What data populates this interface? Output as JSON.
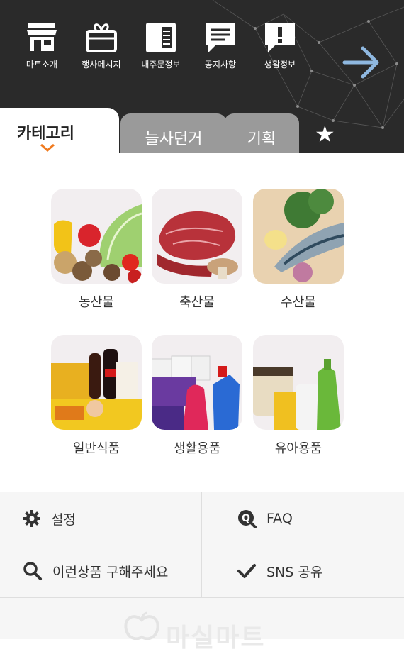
{
  "top_menu": [
    {
      "label": "마트소개",
      "icon": "store-icon"
    },
    {
      "label": "행사메시지",
      "icon": "gift-icon"
    },
    {
      "label": "내주문정보",
      "icon": "book-icon"
    },
    {
      "label": "공지사항",
      "icon": "message-icon"
    },
    {
      "label": "생활정보",
      "icon": "alert-message-icon"
    }
  ],
  "next_icon": "arrow-right-icon",
  "tabs": {
    "active": "카테고리",
    "others": [
      "늘사던거",
      "기획"
    ],
    "favorite_icon": "star-icon"
  },
  "categories": [
    {
      "label": "농산물"
    },
    {
      "label": "축산물"
    },
    {
      "label": "수산물"
    },
    {
      "label": "일반식품"
    },
    {
      "label": "생활용품"
    },
    {
      "label": "유아용품"
    }
  ],
  "bottom_menu": {
    "settings": "설정",
    "faq": "FAQ",
    "request": "이런상품 구해주세요",
    "sns": "SNS 공유"
  },
  "logo_text": "마실마트",
  "colors": {
    "accent": "#f07a1e",
    "header_bg": "#2a2a2a",
    "tab_gray": "#9a9a9a"
  }
}
